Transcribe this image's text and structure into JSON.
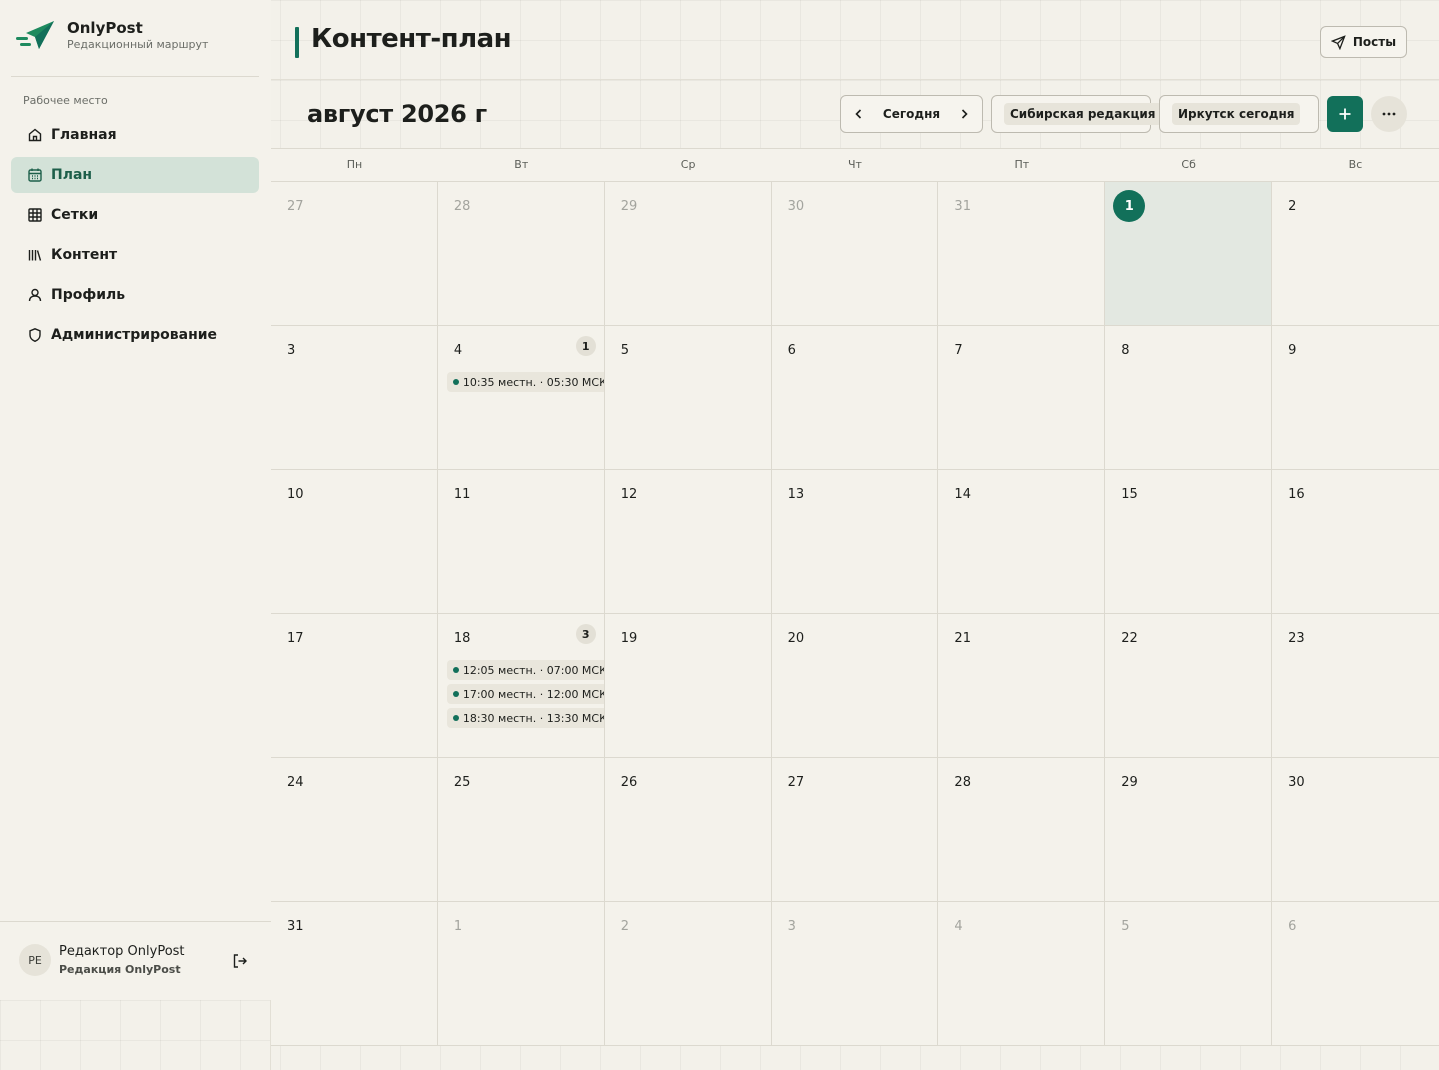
{
  "brand": {
    "name": "OnlyPost",
    "subtitle": "Редакционный маршрут",
    "accent": "#12705a"
  },
  "sidebar": {
    "section_label": "Рабочее место",
    "items": [
      {
        "label": "Главная",
        "icon": "home-icon",
        "active": false
      },
      {
        "label": "План",
        "icon": "calendar-icon",
        "active": true
      },
      {
        "label": "Сетки",
        "icon": "grid-icon",
        "active": false
      },
      {
        "label": "Контент",
        "icon": "library-icon",
        "active": false
      },
      {
        "label": "Профиль",
        "icon": "user-icon",
        "active": false
      },
      {
        "label": "Администрирование",
        "icon": "shield-icon",
        "active": false
      }
    ],
    "user": {
      "initials": "РЕ",
      "name": "Редактор OnlyPost",
      "org": "Редакция OnlyPost"
    }
  },
  "header": {
    "title": "Контент-план",
    "posts_button": "Посты"
  },
  "toolbar": {
    "month": "август 2026 г",
    "today_label": "Сегодня",
    "editorial_select": "Сибирская редакция",
    "timezone_select": "Иркутск сегодня"
  },
  "calendar": {
    "weekdays": [
      "Пн",
      "Вт",
      "Ср",
      "Чт",
      "Пт",
      "Сб",
      "Вс"
    ],
    "weeks": [
      [
        {
          "day": "27",
          "other": true
        },
        {
          "day": "28",
          "other": true
        },
        {
          "day": "29",
          "other": true
        },
        {
          "day": "30",
          "other": true
        },
        {
          "day": "31",
          "other": true
        },
        {
          "day": "1",
          "today": true
        },
        {
          "day": "2"
        }
      ],
      [
        {
          "day": "3"
        },
        {
          "day": "4",
          "count": "1",
          "events": [
            "10:35 местн. · 05:30 МСК"
          ]
        },
        {
          "day": "5"
        },
        {
          "day": "6"
        },
        {
          "day": "7"
        },
        {
          "day": "8"
        },
        {
          "day": "9"
        }
      ],
      [
        {
          "day": "10"
        },
        {
          "day": "11"
        },
        {
          "day": "12"
        },
        {
          "day": "13"
        },
        {
          "day": "14"
        },
        {
          "day": "15"
        },
        {
          "day": "16"
        }
      ],
      [
        {
          "day": "17"
        },
        {
          "day": "18",
          "count": "3",
          "events": [
            "12:05 местн. · 07:00 МСК",
            "17:00 местн. · 12:00 МСК",
            "18:30 местн. · 13:30 МСК"
          ]
        },
        {
          "day": "19"
        },
        {
          "day": "20"
        },
        {
          "day": "21"
        },
        {
          "day": "22"
        },
        {
          "day": "23"
        }
      ],
      [
        {
          "day": "24"
        },
        {
          "day": "25"
        },
        {
          "day": "26"
        },
        {
          "day": "27"
        },
        {
          "day": "28"
        },
        {
          "day": "29"
        },
        {
          "day": "30"
        }
      ],
      [
        {
          "day": "31"
        },
        {
          "day": "1",
          "other": true
        },
        {
          "day": "2",
          "other": true
        },
        {
          "day": "3",
          "other": true
        },
        {
          "day": "4",
          "other": true
        },
        {
          "day": "5",
          "other": true
        },
        {
          "day": "6",
          "other": true
        }
      ]
    ]
  }
}
